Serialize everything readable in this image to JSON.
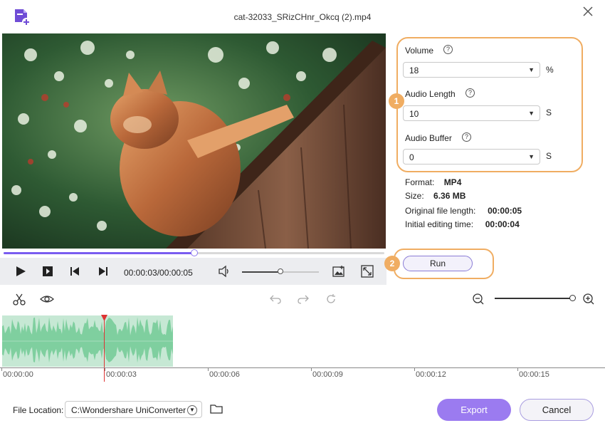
{
  "window": {
    "title": "cat-32033_SRizCHnr_Okcq (2).mp4"
  },
  "player": {
    "current_time": "00:00:03",
    "total_time": "00:00:05",
    "time_display": "00:00:03/00:00:05",
    "progress_fraction": 0.5,
    "volume_fraction": 0.5
  },
  "settings": {
    "volume": {
      "label": "Volume",
      "value": "18",
      "unit": "%"
    },
    "audio_length": {
      "label": "Audio Length",
      "value": "10",
      "unit": "S"
    },
    "audio_buffer": {
      "label": "Audio Buffer",
      "value": "0",
      "unit": "S"
    },
    "help_glyph": "?",
    "badge1": "1",
    "badge2": "2"
  },
  "info": {
    "format_label": "Format:",
    "format_value": "MP4",
    "size_label": "Size:",
    "size_value": "6.36 MB",
    "orig_label": "Original file length:",
    "orig_value": "00:00:05",
    "init_label": "Initial editing time:",
    "init_value": "00:00:04"
  },
  "run": {
    "label": "Run"
  },
  "timeline": {
    "ticks": [
      "00:00:00",
      "00:00:03",
      "00:00:06",
      "00:00:09",
      "00:00:12",
      "00:00:15"
    ],
    "playhead_time": "00:00:03"
  },
  "footer": {
    "location_label": "File Location:",
    "location_value": "C:\\Wondershare UniConverter",
    "export_label": "Export",
    "cancel_label": "Cancel"
  },
  "colors": {
    "accent": "#9b7bf0",
    "highlight": "#f0ad62",
    "waveform": "#7fcf9f",
    "playhead": "#dd3333"
  },
  "icons": [
    "add-file-icon",
    "close-icon",
    "play-icon",
    "stop-icon",
    "prev-frame-icon",
    "next-frame-icon",
    "volume-icon",
    "snapshot-icon",
    "fullscreen-icon",
    "scissors-icon",
    "eye-icon",
    "undo-icon",
    "redo-icon",
    "reset-icon",
    "zoom-out-icon",
    "zoom-in-icon",
    "folder-icon",
    "chevron-down-icon"
  ]
}
